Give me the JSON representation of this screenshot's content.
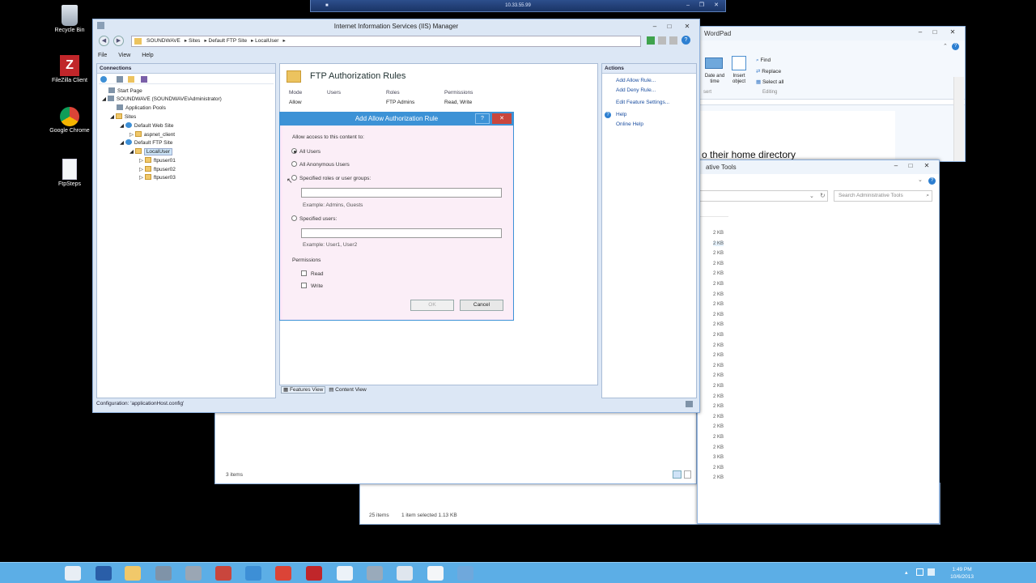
{
  "rdp": {
    "title": "10.33.55.99"
  },
  "desktop": {
    "icons": [
      {
        "label": "Recycle Bin",
        "icon": "recycle-bin-icon"
      },
      {
        "label": "FileZilla Client",
        "icon": "filezilla-icon"
      },
      {
        "label": "Google Chrome",
        "icon": "chrome-icon"
      },
      {
        "label": "FtpSteps",
        "icon": "document-icon"
      }
    ]
  },
  "iis": {
    "title": "Internet Information Services (IIS) Manager",
    "breadcrumb": [
      "SOUNDWAVE",
      "Sites",
      "Default FTP Site",
      "LocalUser"
    ],
    "menu": [
      "File",
      "View",
      "Help"
    ],
    "connections": {
      "header": "Connections",
      "tree": [
        "Start Page",
        "SOUNDWAVE (SOUNDWAVE\\Administrator)",
        "Application Pools",
        "Sites",
        "Default Web Site",
        "aspnet_client",
        "Default FTP Site",
        "LocalUser",
        "ftpuser01",
        "ftpuser02",
        "ftpuser03"
      ]
    },
    "feature": {
      "title": "FTP Authorization Rules",
      "columns": [
        "Mode",
        "Users",
        "Roles",
        "Permissions"
      ],
      "rows": [
        {
          "mode": "Allow",
          "users": "",
          "roles": "FTP Admins",
          "permissions": "Read, Write"
        }
      ],
      "views": [
        "Features View",
        "Content View"
      ]
    },
    "actions": {
      "header": "Actions",
      "items": [
        "Add Allow Rule...",
        "Add Deny Rule...",
        "Edit Feature Settings...",
        "Help",
        "Online Help"
      ]
    },
    "status": "Configuration: 'applicationHost.config'"
  },
  "dialog": {
    "title": "Add Allow Authorization Rule",
    "intro": "Allow access to this content to:",
    "options": [
      "All Users",
      "All Anonymous Users",
      "Specified roles or user groups:",
      "Specified users:"
    ],
    "selected": "All Users",
    "roles_example": "Example: Admins, Guests",
    "users_example": "Example: User1, User2",
    "permissions_label": "Permissions",
    "permissions": [
      "Read",
      "Write"
    ],
    "ok": "OK",
    "cancel": "Cancel"
  },
  "wordpad": {
    "title": "WordPad",
    "ribbon": {
      "datetime": "Date and time",
      "insert_object": "Insert object",
      "find": "Find",
      "replace": "Replace",
      "select_all": "Select all",
      "group_insert": "sert",
      "group_editing": "Editing"
    },
    "doc_text": "o their home directory"
  },
  "admintools": {
    "title": "ative Tools",
    "search_placeholder": "Search Administrative Tools",
    "sizes": [
      "2 KB",
      "2 KB",
      "2 KB",
      "2 KB",
      "2 KB",
      "2 KB",
      "2 KB",
      "2 KB",
      "2 KB",
      "2 KB",
      "2 KB",
      "2 KB",
      "2 KB",
      "2 KB",
      "2 KB",
      "2 KB",
      "2 KB",
      "2 KB",
      "2 KB",
      "2 KB",
      "2 KB",
      "2 KB",
      "3 KB",
      "2 KB",
      "2 KB"
    ]
  },
  "explorer": {
    "status": "3 items"
  },
  "explorer2": {
    "count": "25 items",
    "selected": "1 item selected  1.13 KB"
  },
  "taskbar": {
    "time": "1:49 PM",
    "date": "10/6/2013",
    "apps": [
      "server-manager-icon",
      "powershell-icon",
      "file-explorer-icon",
      "iis-icon",
      "tools-icon",
      "stack-icon",
      "ie-icon",
      "chrome-icon",
      "filezilla-icon",
      "notepad-icon",
      "network-icon",
      "shortcut-icon",
      "wordpad-icon",
      "snip-icon"
    ]
  }
}
